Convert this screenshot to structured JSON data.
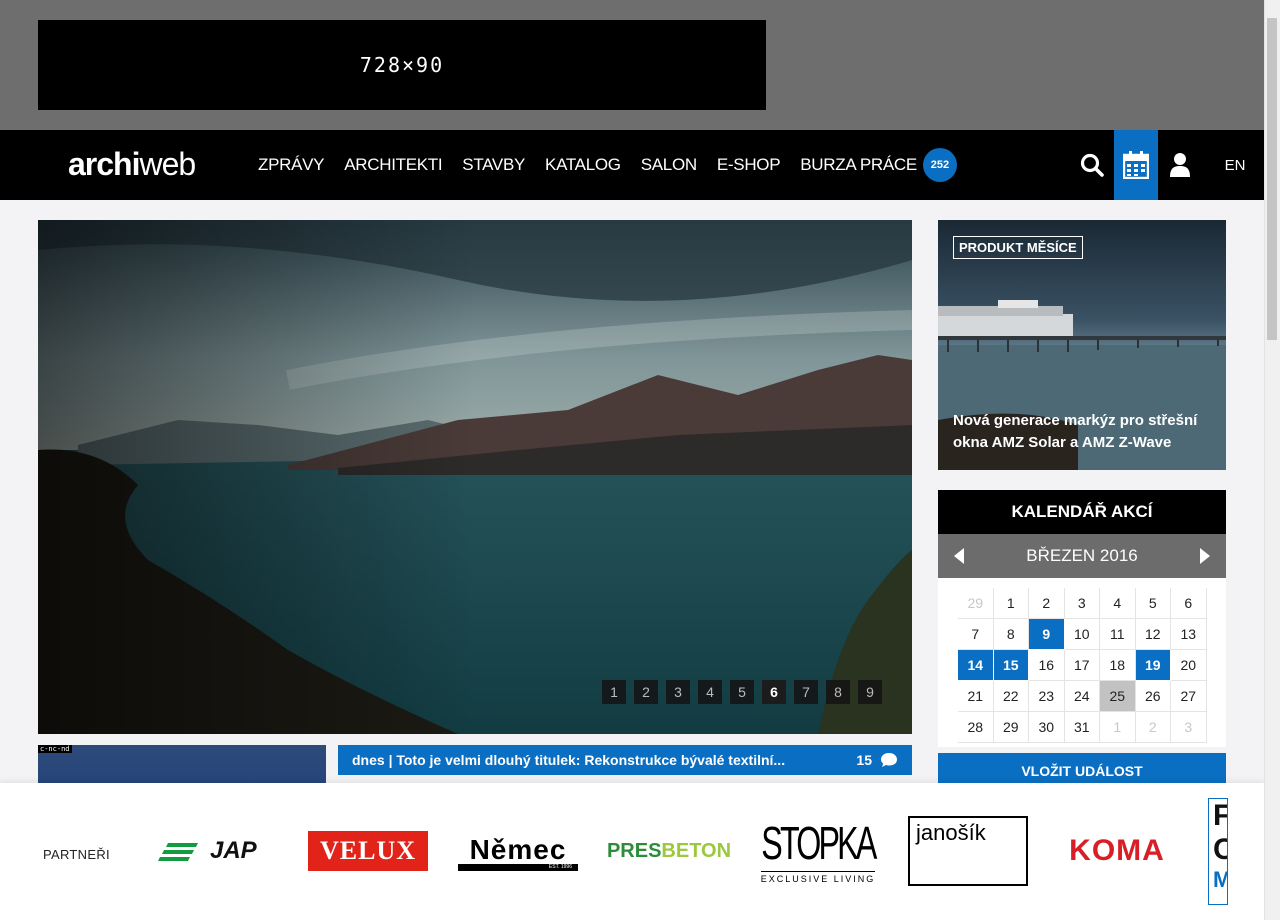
{
  "ad": {
    "label": "728×90"
  },
  "nav": {
    "logo_bold": "archi",
    "logo_light": "web",
    "items": [
      "ZPRÁVY",
      "ARCHITEKTI",
      "STAVBY",
      "KATALOG",
      "SALON",
      "E-SHOP",
      "BURZA PRÁCE"
    ],
    "jobs_badge": "252",
    "lang": "EN"
  },
  "hero": {
    "pages": [
      "1",
      "2",
      "3",
      "4",
      "5",
      "6",
      "7",
      "8",
      "9"
    ],
    "current_page": "6"
  },
  "thumb": {
    "license": "c-nc-nd"
  },
  "ticker": {
    "text": "dnes | Toto je velmi dlouhý titulek: Rekonstrukce bývalé textilní...",
    "comments": "15"
  },
  "product": {
    "tag": "PRODUKT MĚSÍCE",
    "caption": "Nová generace markýz pro střešní okna AMZ Solar a AMZ Z-Wave"
  },
  "calendar": {
    "title": "KALENDÁŘ AKCÍ",
    "month": "BŘEZEN 2016",
    "add_label": "VLOŽIT UDÁLOST",
    "days": [
      {
        "d": "29",
        "s": "muted"
      },
      {
        "d": "1",
        "s": ""
      },
      {
        "d": "2",
        "s": ""
      },
      {
        "d": "3",
        "s": ""
      },
      {
        "d": "4",
        "s": ""
      },
      {
        "d": "5",
        "s": ""
      },
      {
        "d": "6",
        "s": ""
      },
      {
        "d": "7",
        "s": ""
      },
      {
        "d": "8",
        "s": ""
      },
      {
        "d": "9",
        "s": "ev"
      },
      {
        "d": "10",
        "s": ""
      },
      {
        "d": "11",
        "s": ""
      },
      {
        "d": "12",
        "s": ""
      },
      {
        "d": "13",
        "s": ""
      },
      {
        "d": "14",
        "s": "ev"
      },
      {
        "d": "15",
        "s": "ev"
      },
      {
        "d": "16",
        "s": ""
      },
      {
        "d": "17",
        "s": ""
      },
      {
        "d": "18",
        "s": ""
      },
      {
        "d": "19",
        "s": "ev"
      },
      {
        "d": "20",
        "s": ""
      },
      {
        "d": "21",
        "s": ""
      },
      {
        "d": "22",
        "s": ""
      },
      {
        "d": "23",
        "s": ""
      },
      {
        "d": "24",
        "s": ""
      },
      {
        "d": "25",
        "s": "today"
      },
      {
        "d": "26",
        "s": ""
      },
      {
        "d": "27",
        "s": ""
      },
      {
        "d": "28",
        "s": ""
      },
      {
        "d": "29",
        "s": ""
      },
      {
        "d": "30",
        "s": ""
      },
      {
        "d": "31",
        "s": ""
      },
      {
        "d": "1",
        "s": "muted"
      },
      {
        "d": "2",
        "s": "muted"
      },
      {
        "d": "3",
        "s": "muted"
      }
    ]
  },
  "partners": {
    "label": "PARTNEŘI",
    "logos": {
      "jap": "JAP",
      "velux": "VELUX",
      "nemec": "Němec",
      "nemec_sub": "EST. 1996",
      "presbeton_a": "PRES",
      "presbeton_b": "BETON",
      "stopka": "STOPKA",
      "stopka_sub": "EXCLUSIVE LIVING",
      "janosik": "janošík",
      "koma": "KOMA",
      "cut_a": "F",
      "cut_b": "C",
      "cut_c": "M"
    }
  },
  "colors": {
    "accent": "#0a6fc2",
    "nav_bg": "#000000",
    "ad_bg": "#6e6e6e",
    "velux_red": "#e2231a",
    "koma_red": "#d81e26",
    "jap_green": "#129b3f"
  }
}
